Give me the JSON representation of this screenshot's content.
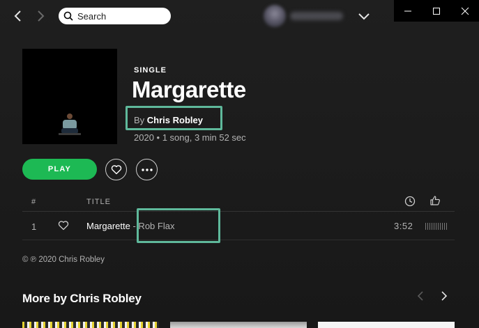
{
  "topbar": {
    "back_icon": "chevron-left-icon",
    "forward_icon": "chevron-right-icon",
    "search_placeholder": "Search",
    "profile_dropdown_icon": "chevron-down-icon"
  },
  "window_controls": [
    "minimize-icon",
    "maximize-icon",
    "close-icon"
  ],
  "album": {
    "type": "SINGLE",
    "title": "Margarette",
    "by_prefix": "By",
    "artist": "Chris Robley",
    "meta": "2020 • 1 song, 3 min 52 sec"
  },
  "actions": {
    "play_label": "PLAY"
  },
  "tracklist": {
    "col_number": "#",
    "col_title": "TITLE",
    "tracks": [
      {
        "number": "1",
        "title": "Margarette",
        "featured": " - Rob Flax",
        "duration": "3:52",
        "popularity": 0.0
      }
    ]
  },
  "copyright": "© ℗ 2020 Chris Robley",
  "more_section": {
    "title": "More by Chris Robley"
  },
  "colors": {
    "accent": "#1db954",
    "highlight": "#5fb99b",
    "background": "#1c1c1c"
  }
}
